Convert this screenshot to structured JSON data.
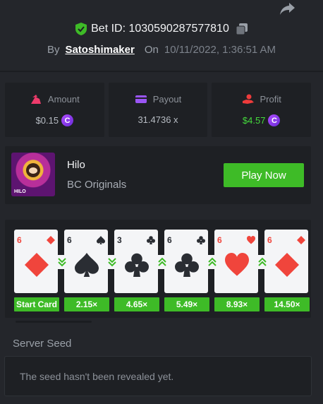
{
  "header": {
    "bet_label": "Bet ID: 1030590287577810",
    "by_label": "By",
    "username": "Satoshimaker",
    "on_label": "On",
    "date": "10/11/2022, 1:36:51 AM"
  },
  "stats": [
    {
      "label": "Amount",
      "value": "$0.15",
      "icon": "money-bag-icon",
      "coin": "C"
    },
    {
      "label": "Payout",
      "value": "31.4736 x",
      "icon": "wallet-icon"
    },
    {
      "label": "Profit",
      "value": "$4.57",
      "icon": "hand-coin-icon",
      "coin": "C"
    }
  ],
  "game": {
    "title": "Hilo",
    "provider": "BC Originals",
    "thumb_label": "HILO",
    "play_label": "Play Now"
  },
  "cards": [
    {
      "rank": "6",
      "suit": "diamond",
      "color": "red",
      "multiplier": "Start Card"
    },
    {
      "rank": "6",
      "suit": "spade",
      "color": "black",
      "multiplier": "2.15×",
      "arrow": "lower"
    },
    {
      "rank": "3",
      "suit": "club",
      "color": "black",
      "multiplier": "4.65×",
      "arrow": "lower"
    },
    {
      "rank": "6",
      "suit": "club",
      "color": "black",
      "multiplier": "5.49×",
      "arrow": "higher"
    },
    {
      "rank": "6",
      "suit": "heart",
      "color": "red",
      "multiplier": "8.93×",
      "arrow": "higher"
    },
    {
      "rank": "6",
      "suit": "diamond",
      "color": "red",
      "multiplier": "14.50×",
      "arrow": "higher"
    }
  ],
  "seed": {
    "title": "Server Seed",
    "message": "The seed hasn't been revealed yet."
  },
  "colors": {
    "accent_green": "#3ebb27",
    "profit_green": "#44d93c",
    "coin_purple": "#8a3cf0"
  }
}
